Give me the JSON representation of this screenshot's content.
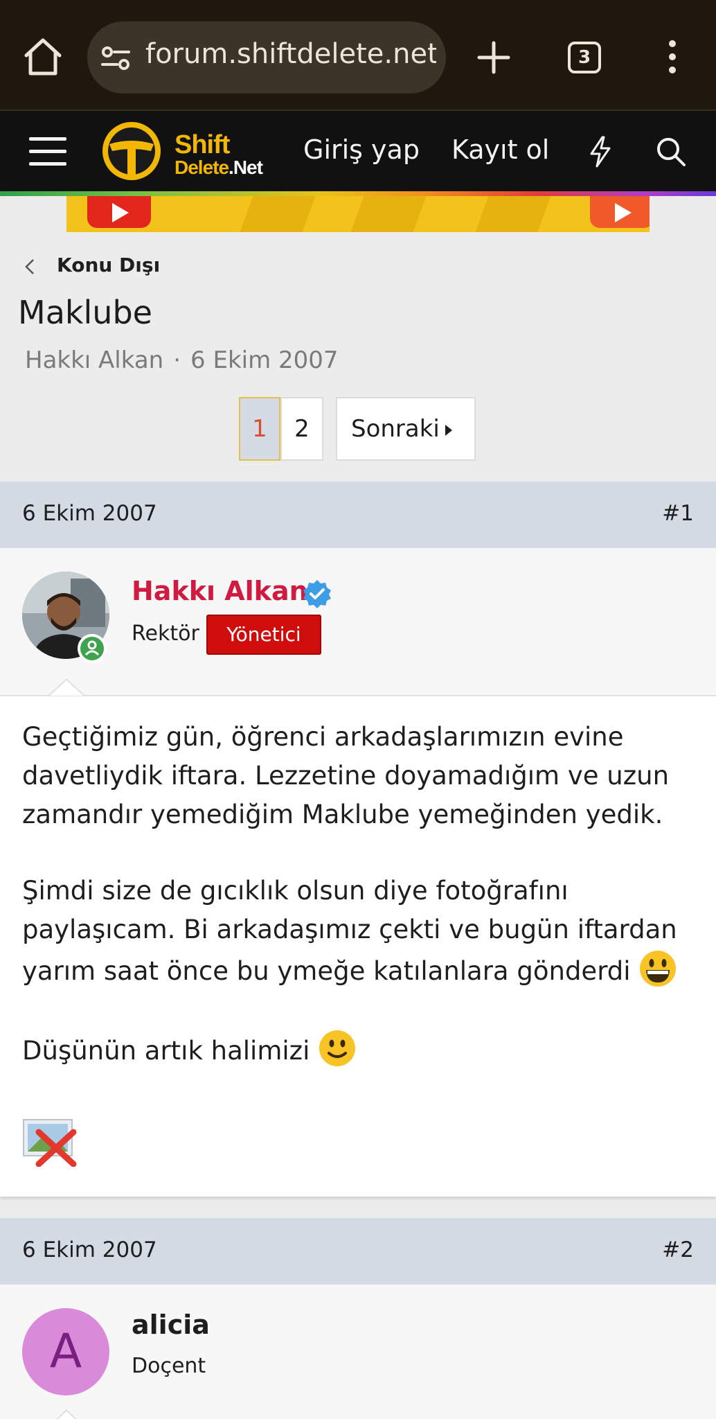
{
  "browser": {
    "url": "forum.shiftdelete.net/",
    "tab_count": "3",
    "icons": [
      "home-icon",
      "site-settings-icon",
      "new-tab-icon",
      "tabs-icon",
      "overflow-menu-icon"
    ]
  },
  "site": {
    "logo_line1": "Shift",
    "logo_line2": "Delete",
    "logo_line2_suffix": ".Net",
    "login_label": "Giriş yap",
    "register_label": "Kayıt ol",
    "icons": [
      "hamburger-icon",
      "lightning-icon",
      "search-icon"
    ],
    "brand_color": "#f2b705"
  },
  "thread": {
    "breadcrumb": "Konu Dışı",
    "title": "Maklube",
    "author": "Hakkı Alkan",
    "date": "6 Ekim 2007",
    "pagination": {
      "current": "1",
      "pages": [
        "1",
        "2"
      ],
      "next_label": "Sonraki"
    }
  },
  "posts": [
    {
      "date": "6 Ekim 2007",
      "number": "#1",
      "username": "Hakkı Alkan",
      "user_title": "Rektör",
      "badge": "Yönetici",
      "username_color": "#cf1b3f",
      "badge_color": "#cf0d0d",
      "verified": true,
      "online": true,
      "body": {
        "p1": "Geçtiğimiz gün, öğrenci arkadaşlarımızın evine davetliydik iftara. Lezzetine doyamadığım ve uzun zamandır yemediğim Maklube yemeğinden yedik.",
        "p2": "Şimdi size de gıcıklık olsun diye fotoğrafını paylaşıcam. Bi arkadaşımız çekti ve bugün iftardan yarım saat önce bu ymeğe katılanlara gönderdi",
        "p3": "Düşünün artık halimizi"
      }
    },
    {
      "date": "6 Ekim 2007",
      "number": "#2",
      "username": "alicia",
      "avatar_letter": "A",
      "user_title": "Doçent",
      "avatar_color": "#d98ad9"
    }
  ]
}
